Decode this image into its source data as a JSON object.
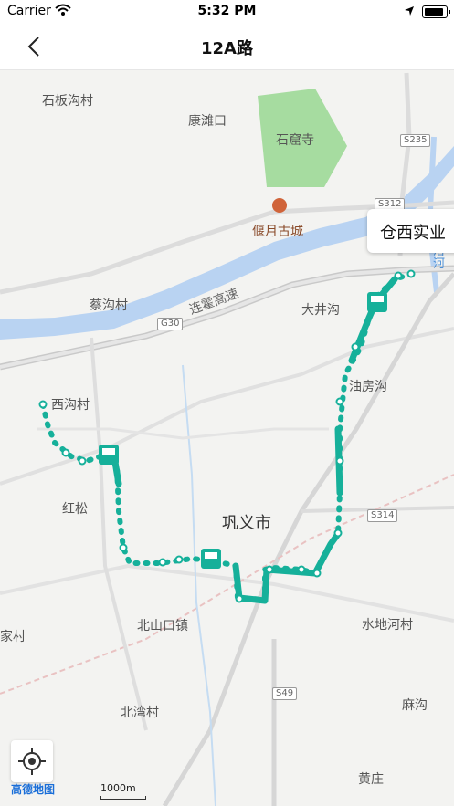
{
  "status": {
    "carrier": "Carrier",
    "time": "5:32 PM"
  },
  "nav": {
    "title": "12A路"
  },
  "map": {
    "labels": {
      "shibangoucun": "石板沟村",
      "kangtankou": "康滩口",
      "shikusi": "石窟寺",
      "yanyuegucheng": "偃月古城",
      "caigoucun": "蔡沟村",
      "lianhuo": "连霍高速",
      "dajinggou": "大井沟",
      "xigoucun": "西沟村",
      "youfanggou": "油房沟",
      "hongsong": "红松",
      "gongyishi": "巩义市",
      "beishankouzhen": "北山口镇",
      "shuidihecun": "水地河村",
      "jiacun": "家村",
      "beiwancun": "北湾村",
      "gougou": "麻沟",
      "huangzhuang": "黄庄",
      "yiluohe": "伊洛河"
    },
    "shields": {
      "s235": "S235",
      "s312": "S312",
      "g30": "G30",
      "s314": "S314",
      "s49": "S49"
    },
    "tooltip": "仓西实业",
    "logo": "高德地图",
    "scale": "1000m",
    "colors": {
      "route": "#16b09a",
      "river": "#b9d3f2",
      "park": "#a6dca0"
    }
  }
}
